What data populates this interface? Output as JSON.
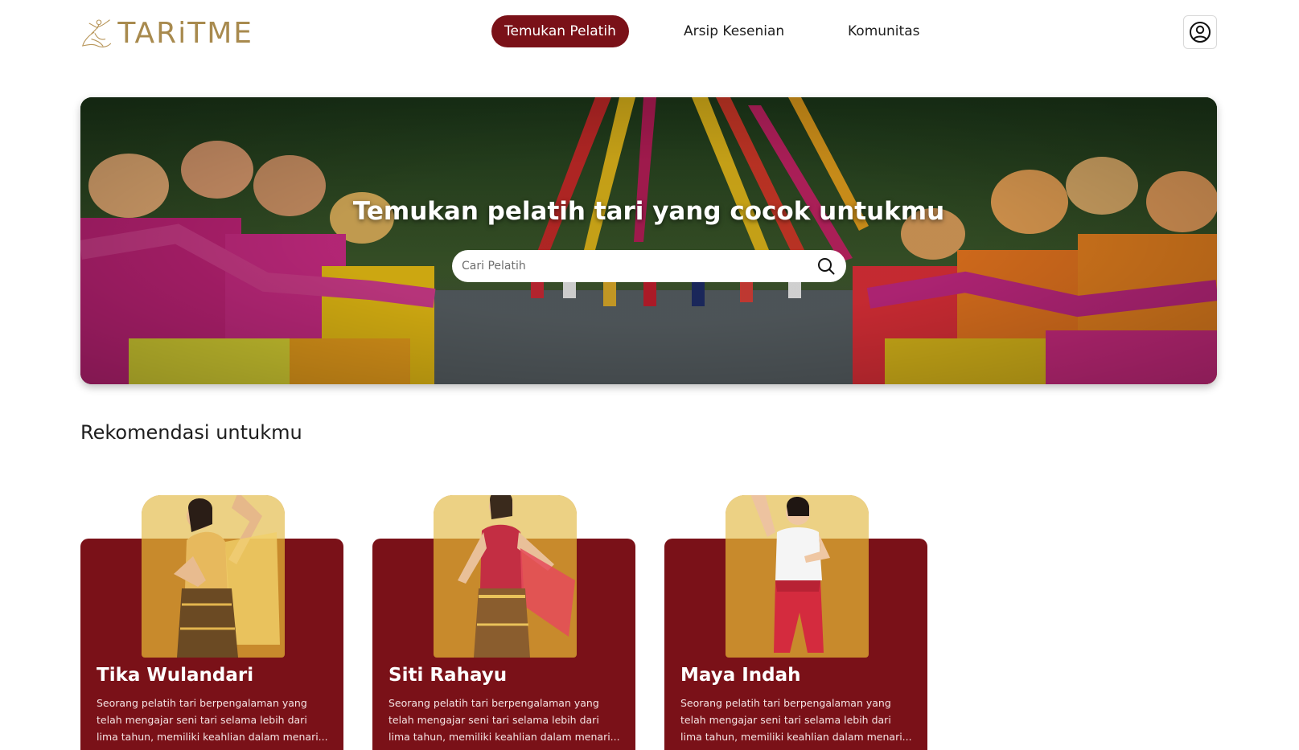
{
  "brand": {
    "name": "TARiTME",
    "logo_icon": "dancer-logo-icon"
  },
  "nav": {
    "items": [
      {
        "label": "Temukan Pelatih",
        "active": true
      },
      {
        "label": "Arsip Kesenian",
        "active": false
      },
      {
        "label": "Komunitas",
        "active": false
      }
    ],
    "profile_icon": "user-circle-icon"
  },
  "hero": {
    "title": "Temukan pelatih tari yang cocok untukmu",
    "search_placeholder": "Cari Pelatih",
    "search_value": "",
    "search_icon": "search-icon"
  },
  "recommendations": {
    "title": "Rekomendasi untukmu",
    "cards": [
      {
        "name": "Tika Wulandari",
        "desc_line1": "Seorang pelatih tari berpengalaman yang",
        "desc_line2": "telah mengajar seni tari selama lebih dari",
        "desc_line3": "lima tahun, memiliki keahlian dalam menari..."
      },
      {
        "name": "Siti Rahayu",
        "desc_line1": "Seorang pelatih tari berpengalaman yang",
        "desc_line2": "telah mengajar seni tari selama lebih dari",
        "desc_line3": "lima tahun, memiliki keahlian dalam menari..."
      },
      {
        "name": "Maya Indah",
        "desc_line1": "Seorang pelatih tari berpengalaman yang",
        "desc_line2": "telah mengajar seni tari selama lebih dari",
        "desc_line3": "lima tahun, memiliki keahlian dalam menari..."
      }
    ]
  },
  "colors": {
    "primary": "#7a1118",
    "card_photo_top": "#ecd184",
    "card_photo_bottom": "#c88a2c",
    "logo_gold": "#a88a4e"
  }
}
